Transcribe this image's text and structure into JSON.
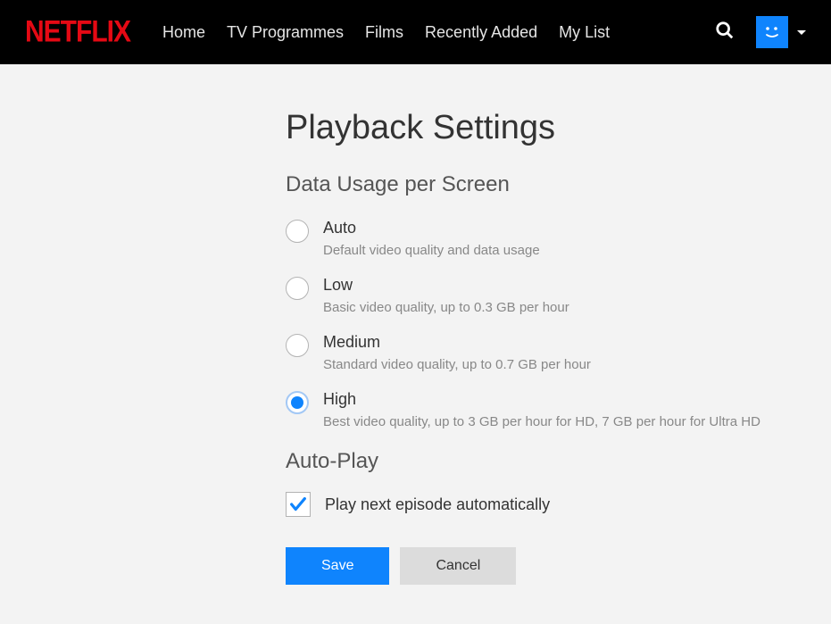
{
  "brand": "NETFLIX",
  "nav": {
    "items": [
      "Home",
      "TV Programmes",
      "Films",
      "Recently Added",
      "My List"
    ]
  },
  "page": {
    "title": "Playback Settings"
  },
  "data_usage": {
    "title": "Data Usage per Screen",
    "selected_index": 3,
    "options": [
      {
        "label": "Auto",
        "description": "Default video quality and data usage"
      },
      {
        "label": "Low",
        "description": "Basic video quality, up to 0.3 GB per hour"
      },
      {
        "label": "Medium",
        "description": "Standard video quality, up to 0.7 GB per hour"
      },
      {
        "label": "High",
        "description": "Best video quality, up to 3 GB per hour for HD, 7 GB per hour for Ultra HD"
      }
    ]
  },
  "autoplay": {
    "title": "Auto-Play",
    "checked": true,
    "label": "Play next episode automatically"
  },
  "buttons": {
    "save": "Save",
    "cancel": "Cancel"
  }
}
